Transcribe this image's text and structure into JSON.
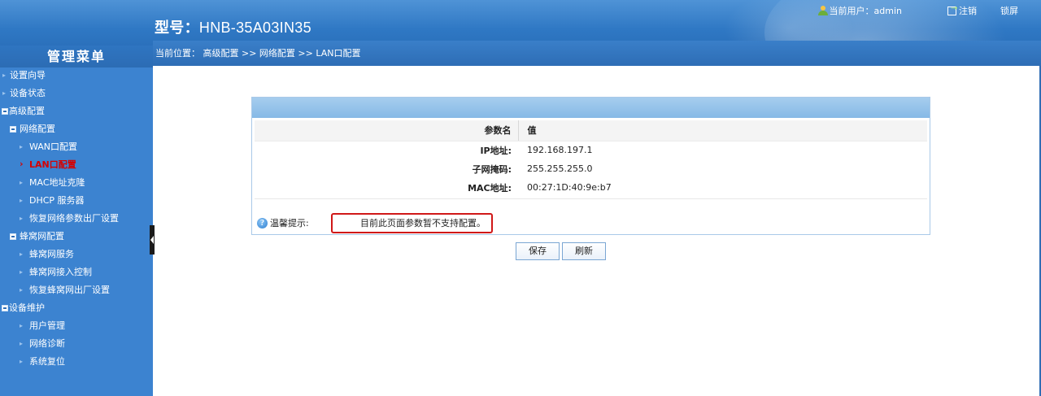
{
  "header": {
    "model_label": "型号：",
    "model_value": "HNB-35A03IN35",
    "current_user_label": "当前用户：admin",
    "logout_label": "注销",
    "lock_label": "锁屏"
  },
  "breadcrumb": "当前位置： 高级配置 >> 网络配置 >> LAN口配置",
  "sidebar": {
    "title": "管理菜单",
    "items": [
      {
        "label": "设置向导"
      },
      {
        "label": "设备状态"
      },
      {
        "label": "高级配置"
      },
      {
        "label": "网络配置"
      },
      {
        "label": "WAN口配置"
      },
      {
        "label": "LAN口配置"
      },
      {
        "label": "MAC地址克隆"
      },
      {
        "label": "DHCP 服务器"
      },
      {
        "label": "恢复网络参数出厂设置"
      },
      {
        "label": "蜂窝网配置"
      },
      {
        "label": "蜂窝网服务"
      },
      {
        "label": "蜂窝网接入控制"
      },
      {
        "label": "恢复蜂窝网出厂设置"
      },
      {
        "label": "设备维护"
      },
      {
        "label": "用户管理"
      },
      {
        "label": "网络诊断"
      },
      {
        "label": "系统复位"
      }
    ]
  },
  "table": {
    "headers": [
      "参数名",
      "值"
    ],
    "rows": [
      {
        "name": "IP地址:",
        "value": "192.168.197.1"
      },
      {
        "name": "子网掩码:",
        "value": "255.255.255.0"
      },
      {
        "name": "MAC地址:",
        "value": "00:27:1D:40:9e:b7"
      }
    ]
  },
  "tip": {
    "label": "温馨提示:",
    "message": "目前此页面参数暂不支持配置。"
  },
  "buttons": {
    "save": "保存",
    "refresh": "刷新"
  },
  "colors": {
    "header_blue": "#2f78c4",
    "sidebar_blue": "#3c83d0",
    "active_red": "#d60000",
    "tip_border_red": "#d01818"
  }
}
